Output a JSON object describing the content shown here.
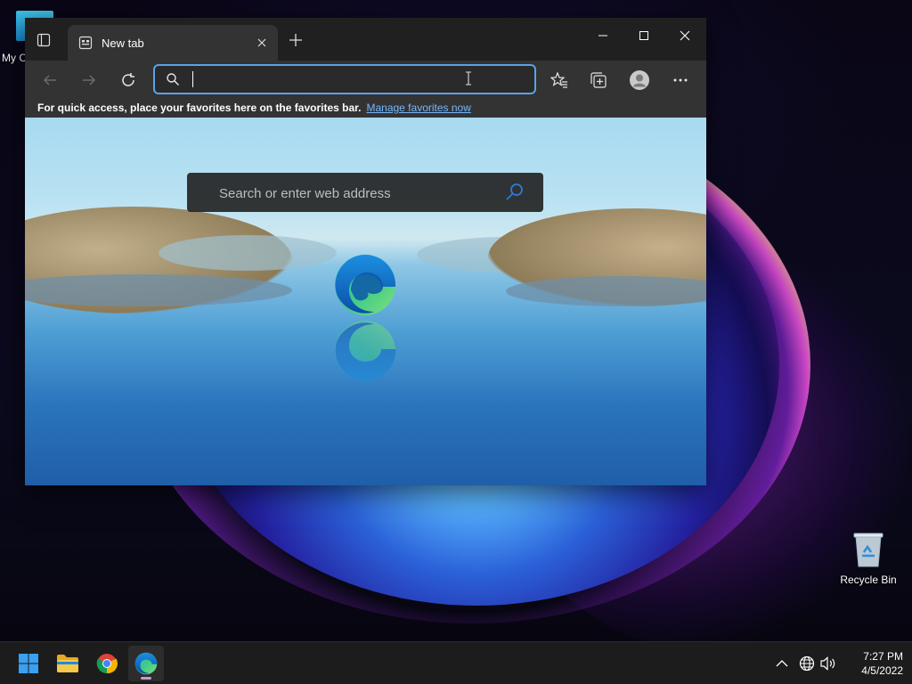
{
  "desktop": {
    "icons": [
      {
        "label": "My C"
      },
      {
        "label": "Recycle Bin"
      }
    ]
  },
  "browser": {
    "tab": {
      "title": "New tab"
    },
    "address_bar": {
      "value": "",
      "placeholder": ""
    },
    "favorites_bar": {
      "message": "For quick access, place your favorites here on the favorites bar.",
      "link": "Manage favorites now"
    },
    "new_tab_page": {
      "search_placeholder": "Search or enter web address"
    }
  },
  "taskbar": {
    "clock": {
      "time": "7:27 PM",
      "date": "4/5/2022"
    }
  },
  "colors": {
    "accent": "#5aa2e6",
    "link": "#74b7ff",
    "toolbar": "#333333",
    "titlebar": "#202020",
    "taskbar": "#1c1c1c"
  }
}
